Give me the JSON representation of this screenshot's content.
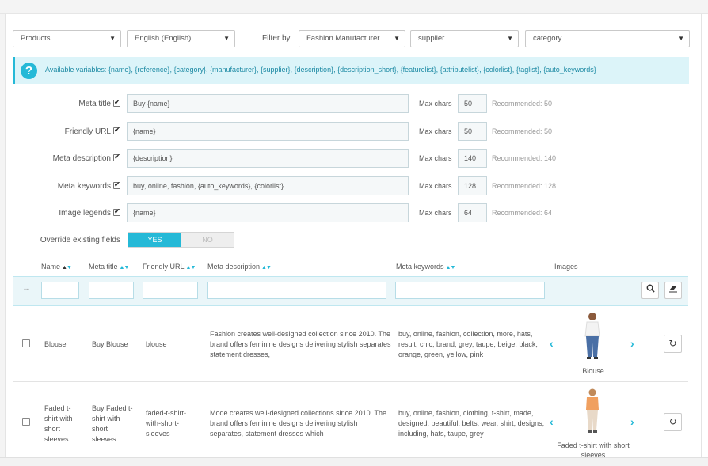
{
  "toolbar": {
    "entity_select": "Products",
    "language_select": "English (English)",
    "filter_label": "Filter by",
    "manufacturer_select": "Fashion Manufacturer",
    "supplier_select": "supplier",
    "category_select": "category"
  },
  "alert": {
    "text": "Available variables: {name}, {reference}, {category}, {manufacturer}, {supplier}, {description}, {description_short}, {featurelist}, {attributelist}, {colorlist}, {taglist}, {auto_keywords}"
  },
  "fields": [
    {
      "label": "Meta title",
      "value": "Buy {name}",
      "max_label": "Max chars",
      "max": "50",
      "recommended": "Recommended: 50"
    },
    {
      "label": "Friendly URL",
      "value": "{name}",
      "max_label": "Max chars",
      "max": "50",
      "recommended": "Recommended: 50"
    },
    {
      "label": "Meta description",
      "value": "{description}",
      "max_label": "Max chars",
      "max": "140",
      "recommended": "Recommended: 140"
    },
    {
      "label": "Meta keywords",
      "value": "buy, online, fashion,  {auto_keywords},  {colorlist}",
      "max_label": "Max chars",
      "max": "128",
      "recommended": "Recommended: 128"
    },
    {
      "label": "Image legends",
      "value": "{name}",
      "max_label": "Max chars",
      "max": "64",
      "recommended": "Recommended: 64"
    }
  ],
  "override": {
    "label": "Override existing fields",
    "yes": "YES",
    "no": "NO"
  },
  "table": {
    "headers": [
      "Name",
      "Meta title",
      "Friendly URL",
      "Meta description",
      "Meta keywords",
      "Images"
    ],
    "filter_dash": "--",
    "rows": [
      {
        "name": "Blouse",
        "meta_title": "Buy Blouse",
        "friendly_url": "blouse",
        "meta_description": "Fashion creates well-designed collection since 2010. The brand offers feminine designs delivering stylish separates statement dresses,",
        "meta_keywords": "buy, online, fashion, collection, more, hats, result, chic, brand, grey, taupe, beige, black, orange, green, yellow, pink",
        "image_caption": "Blouse"
      },
      {
        "name": "Faded t-shirt with short sleeves",
        "meta_title": "Buy Faded t-shirt with short sleeves",
        "friendly_url": "faded-t-shirt-with-short-sleeves",
        "meta_description": "Mode creates well-designed collections since 2010. The brand offers feminine designs delivering stylish separates, statement dresses which",
        "meta_keywords": "buy, online, fashion, clothing, t-shirt, made, designed, beautiful, belts, wear, shirt, designs, including, hats, taupe, grey",
        "image_caption": "Faded t-shirt with short sleeves"
      }
    ]
  },
  "colors": {
    "accent": "#25b9d7",
    "alert_bg": "#dcf4f9",
    "input_bg": "#f5f8f9"
  }
}
